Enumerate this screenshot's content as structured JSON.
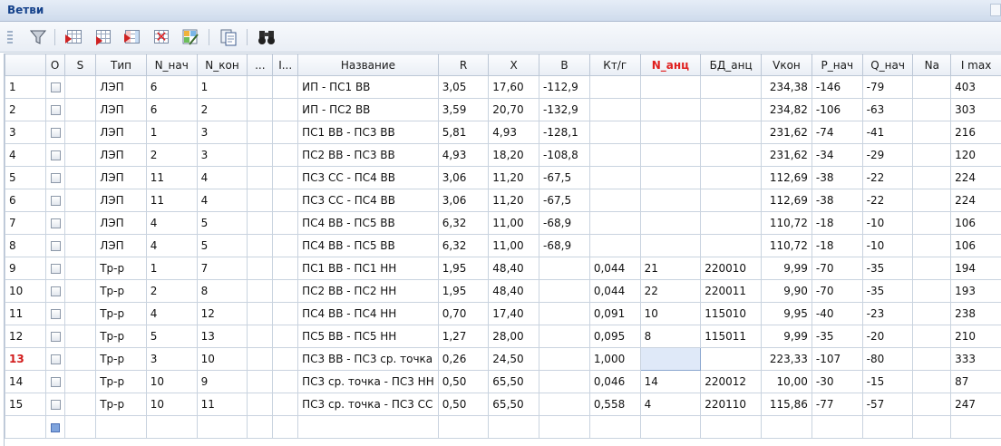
{
  "window": {
    "title": "Ветви"
  },
  "toolbar": {
    "buttons": [
      {
        "name": "filter-icon"
      },
      {
        "name": "insert-row-icon"
      },
      {
        "name": "add-row-icon"
      },
      {
        "name": "copy-row-icon"
      },
      {
        "name": "delete-row-icon"
      },
      {
        "name": "edit-table-icon"
      },
      {
        "name": "copy-clipboard-icon"
      },
      {
        "name": "binoculars-icon"
      }
    ]
  },
  "table": {
    "columns": [
      "",
      "O",
      "S",
      "Тип",
      "N_нач",
      "N_кон",
      "...",
      "I...",
      "Название",
      "R",
      "X",
      "B",
      "Кт/г",
      "N_анц",
      "БД_анц",
      "Vкон",
      "P_нач",
      "Q_нач",
      "Na",
      "I max"
    ],
    "highlighted_column": "N_анц",
    "rows": [
      {
        "n": "1",
        "type": "ЛЭП",
        "n_start": "6",
        "n_end": "1",
        "name": "ИП - ПС1 ВВ",
        "r": "3,05",
        "x": "17,60",
        "b": "-112,9",
        "ktg": "",
        "n_anc": "",
        "bd_anc": "",
        "vkon": "234,38",
        "p": "-146",
        "q": "-79",
        "na": "",
        "imax": "403"
      },
      {
        "n": "2",
        "type": "ЛЭП",
        "n_start": "6",
        "n_end": "2",
        "name": "ИП - ПС2 ВВ",
        "r": "3,59",
        "x": "20,70",
        "b": "-132,9",
        "ktg": "",
        "n_anc": "",
        "bd_anc": "",
        "vkon": "234,82",
        "p": "-106",
        "q": "-63",
        "na": "",
        "imax": "303"
      },
      {
        "n": "3",
        "type": "ЛЭП",
        "n_start": "1",
        "n_end": "3",
        "name": "ПС1 ВВ - ПС3 ВВ",
        "r": "5,81",
        "x": "4,93",
        "b": "-128,1",
        "ktg": "",
        "n_anc": "",
        "bd_anc": "",
        "vkon": "231,62",
        "p": "-74",
        "q": "-41",
        "na": "",
        "imax": "216"
      },
      {
        "n": "4",
        "type": "ЛЭП",
        "n_start": "2",
        "n_end": "3",
        "name": "ПС2 ВВ - ПС3 ВВ",
        "r": "4,93",
        "x": "18,20",
        "b": "-108,8",
        "ktg": "",
        "n_anc": "",
        "bd_anc": "",
        "vkon": "231,62",
        "p": "-34",
        "q": "-29",
        "na": "",
        "imax": "120"
      },
      {
        "n": "5",
        "type": "ЛЭП",
        "n_start": "11",
        "n_end": "4",
        "name": "ПС3 СС - ПС4 ВВ",
        "r": "3,06",
        "x": "11,20",
        "b": "-67,5",
        "ktg": "",
        "n_anc": "",
        "bd_anc": "",
        "vkon": "112,69",
        "p": "-38",
        "q": "-22",
        "na": "",
        "imax": "224"
      },
      {
        "n": "6",
        "type": "ЛЭП",
        "n_start": "11",
        "n_end": "4",
        "name": "ПС3 СС - ПС4 ВВ",
        "r": "3,06",
        "x": "11,20",
        "b": "-67,5",
        "ktg": "",
        "n_anc": "",
        "bd_anc": "",
        "vkon": "112,69",
        "p": "-38",
        "q": "-22",
        "na": "",
        "imax": "224"
      },
      {
        "n": "7",
        "type": "ЛЭП",
        "n_start": "4",
        "n_end": "5",
        "name": "ПС4 ВВ - ПС5 ВВ",
        "r": "6,32",
        "x": "11,00",
        "b": "-68,9",
        "ktg": "",
        "n_anc": "",
        "bd_anc": "",
        "vkon": "110,72",
        "p": "-18",
        "q": "-10",
        "na": "",
        "imax": "106"
      },
      {
        "n": "8",
        "type": "ЛЭП",
        "n_start": "4",
        "n_end": "5",
        "name": "ПС4 ВВ - ПС5 ВВ",
        "r": "6,32",
        "x": "11,00",
        "b": "-68,9",
        "ktg": "",
        "n_anc": "",
        "bd_anc": "",
        "vkon": "110,72",
        "p": "-18",
        "q": "-10",
        "na": "",
        "imax": "106"
      },
      {
        "n": "9",
        "type": "Тр-р",
        "n_start": "1",
        "n_end": "7",
        "name": "ПС1 ВВ - ПС1 НН",
        "r": "1,95",
        "x": "48,40",
        "b": "",
        "ktg": "0,044",
        "n_anc": "21",
        "bd_anc": "220010",
        "vkon": "9,99",
        "p": "-70",
        "q": "-35",
        "na": "",
        "imax": "194"
      },
      {
        "n": "10",
        "type": "Тр-р",
        "n_start": "2",
        "n_end": "8",
        "name": "ПС2 ВВ - ПС2 НН",
        "r": "1,95",
        "x": "48,40",
        "b": "",
        "ktg": "0,044",
        "n_anc": "22",
        "bd_anc": "220011",
        "vkon": "9,90",
        "p": "-70",
        "q": "-35",
        "na": "",
        "imax": "193"
      },
      {
        "n": "11",
        "type": "Тр-р",
        "n_start": "4",
        "n_end": "12",
        "name": "ПС4 ВВ - ПС4 НН",
        "r": "0,70",
        "x": "17,40",
        "b": "",
        "ktg": "0,091",
        "n_anc": "10",
        "bd_anc": "115010",
        "vkon": "9,95",
        "p": "-40",
        "q": "-23",
        "na": "",
        "imax": "238"
      },
      {
        "n": "12",
        "type": "Тр-р",
        "n_start": "5",
        "n_end": "13",
        "name": "ПС5 ВВ - ПС5 НН",
        "r": "1,27",
        "x": "28,00",
        "b": "",
        "ktg": "0,095",
        "n_anc": "8",
        "bd_anc": "115011",
        "vkon": "9,99",
        "p": "-35",
        "q": "-20",
        "na": "",
        "imax": "210"
      },
      {
        "n": "13",
        "type": "Тр-р",
        "n_start": "3",
        "n_end": "10",
        "name": "ПС3 ВВ - ПС3 ср. точка",
        "r": "0,26",
        "x": "24,50",
        "b": "",
        "ktg": "1,000",
        "n_anc": "",
        "bd_anc": "",
        "vkon": "223,33",
        "p": "-107",
        "q": "-80",
        "na": "",
        "imax": "333"
      },
      {
        "n": "14",
        "type": "Тр-р",
        "n_start": "10",
        "n_end": "9",
        "name": "ПС3 ср. точка - ПС3 НН",
        "r": "0,50",
        "x": "65,50",
        "b": "",
        "ktg": "0,046",
        "n_anc": "14",
        "bd_anc": "220012",
        "vkon": "10,00",
        "p": "-30",
        "q": "-15",
        "na": "",
        "imax": "87"
      },
      {
        "n": "15",
        "type": "Тр-р",
        "n_start": "10",
        "n_end": "11",
        "name": "ПС3 ср. точка - ПС3 СС",
        "r": "0,50",
        "x": "65,50",
        "b": "",
        "ktg": "0,558",
        "n_anc": "4",
        "bd_anc": "220110",
        "vkon": "115,86",
        "p": "-77",
        "q": "-57",
        "na": "",
        "imax": "247"
      }
    ],
    "active_row": "13"
  }
}
